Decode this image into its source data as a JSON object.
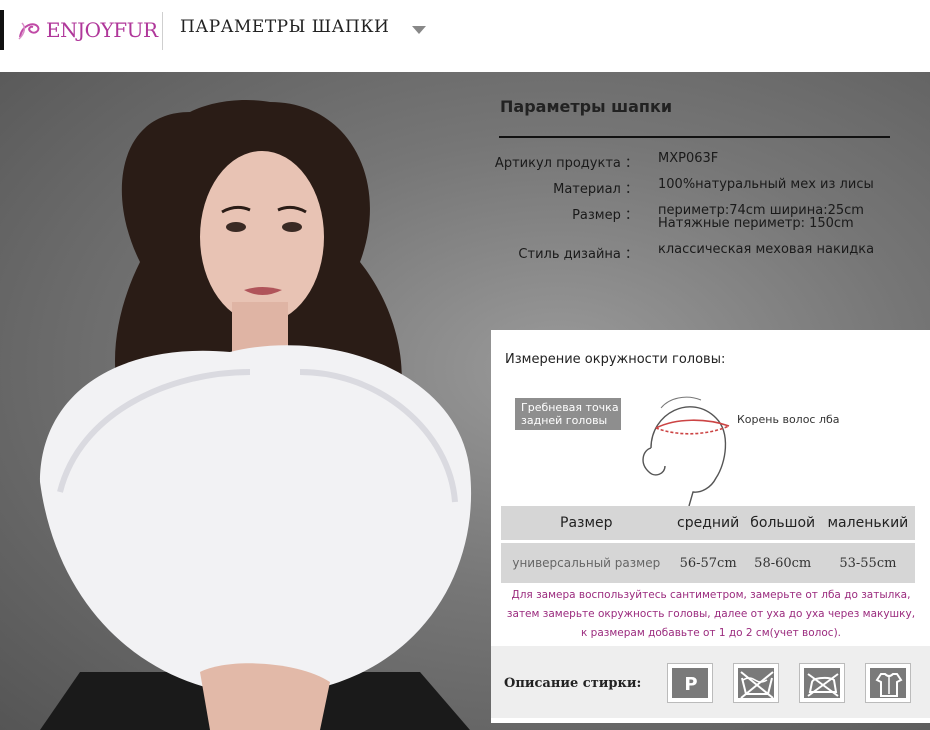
{
  "header": {
    "logo_text": "ENJOYFUR",
    "title": "ПАРАМЕТРЫ ШАПКИ",
    "brand_color": "#b0379a"
  },
  "specs": {
    "title": "Параметры шапки",
    "rows": [
      {
        "label": "Артикул продукта ：",
        "value": "MXP063F"
      },
      {
        "label": "Материал ：",
        "value": "100%натуральный мех из лисы"
      },
      {
        "label": "Размер ：",
        "value": "периметр:74cm  ширина:25cm",
        "value2": "Натяжные периметр:  150cm"
      },
      {
        "label": "Стиль дизайна ：",
        "value": "классическая меховая накидка"
      }
    ]
  },
  "measure": {
    "title": "Измерение окружности головы:",
    "back_point_label": "Гребневая точка задней головы",
    "forehead_label": "Корень волос лба",
    "table": {
      "headers": [
        "Размер",
        "средний",
        "большой",
        "маленький"
      ],
      "row_label": "универсальный размер",
      "values": [
        "56-57cm",
        "58-60cm",
        "53-55cm"
      ]
    },
    "note_lines": [
      "Для замера воспользуйтесь сантиметром, замерьте от лба до затылка,",
      "затем замерьте окружность головы, далее от уха до уха через макушку,",
      "к размерам добавьте от 1 до 2 см(учет волос)."
    ],
    "note_color": "#9b2b7e"
  },
  "washing": {
    "label": "Описание стирки:",
    "icons": [
      "dry-clean-p-icon",
      "no-hand-wash-icon",
      "no-iron-icon",
      "hang-dry-icon"
    ],
    "icon_p_letter": "P"
  }
}
